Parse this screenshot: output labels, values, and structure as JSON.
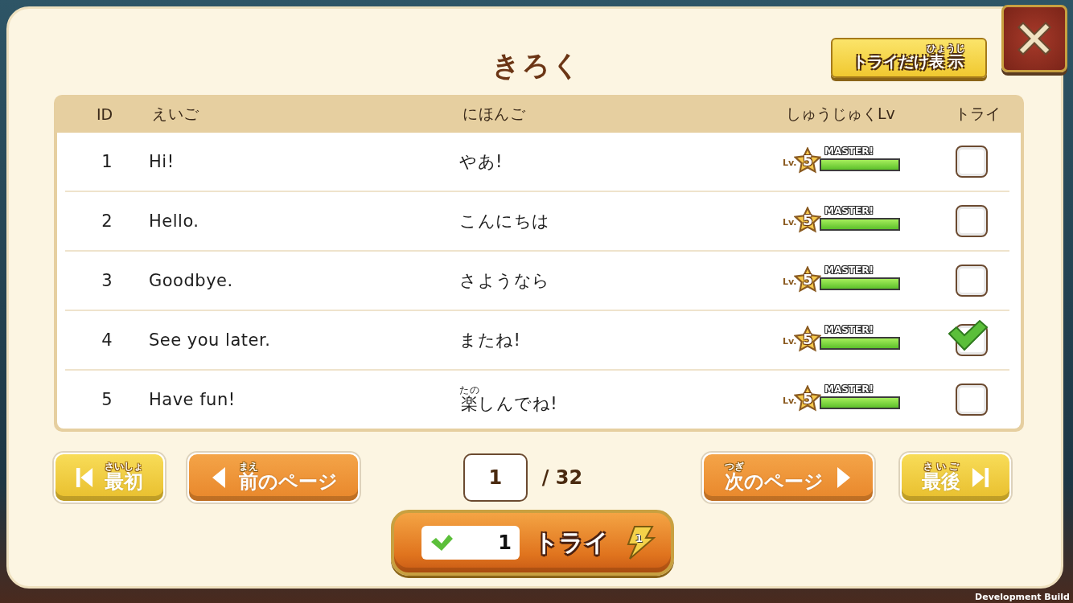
{
  "title": "きろく",
  "filter_button": [
    {
      "text": "トライだけ"
    },
    {
      "text": "表示",
      "ruby": "ひょうじ"
    }
  ],
  "table": {
    "columns": [
      "ID",
      "えいご",
      "にほんご",
      "しゅうじゅくLv",
      "トライ"
    ],
    "rows": [
      {
        "id": "1",
        "english": "Hi!",
        "japanese": [
          {
            "text": "やあ!"
          }
        ],
        "lv_prefix": "Lv.",
        "lv": "5",
        "badge": "MASTER!",
        "level": 1,
        "checked": false
      },
      {
        "id": "2",
        "english": "Hello.",
        "japanese": [
          {
            "text": "こんにちは"
          }
        ],
        "lv_prefix": "Lv.",
        "lv": "5",
        "badge": "MASTER!",
        "level": 1,
        "checked": false
      },
      {
        "id": "3",
        "english": "Goodbye.",
        "japanese": [
          {
            "text": "さようなら"
          }
        ],
        "lv_prefix": "Lv.",
        "lv": "5",
        "badge": "MASTER!",
        "level": 1,
        "checked": false
      },
      {
        "id": "4",
        "english": "See you later.",
        "japanese": [
          {
            "text": "またね!"
          }
        ],
        "lv_prefix": "Lv.",
        "lv": "5",
        "badge": "MASTER!",
        "level": 1,
        "checked": true
      },
      {
        "id": "5",
        "english": "Have fun!",
        "japanese": [
          {
            "text": "楽",
            "ruby": "たの"
          },
          {
            "text": "しんでね!"
          }
        ],
        "lv_prefix": "Lv.",
        "lv": "5",
        "badge": "MASTER!",
        "level": 1,
        "checked": false
      }
    ]
  },
  "pagination": {
    "first": [
      {
        "text": "最初",
        "ruby": "さいしょ"
      }
    ],
    "prev": [
      {
        "text": "前",
        "ruby": "まえ"
      },
      {
        "text": "のページ"
      }
    ],
    "page": "1",
    "total": "/ 32",
    "next": [
      {
        "text": "次",
        "ruby": "つぎ"
      },
      {
        "text": "のページ"
      }
    ],
    "last": [
      {
        "text": "最後",
        "ruby": "さいご"
      }
    ]
  },
  "try_button": {
    "count": "1",
    "label": "トライ",
    "cost": "1"
  },
  "footer_note": "Development Build"
}
